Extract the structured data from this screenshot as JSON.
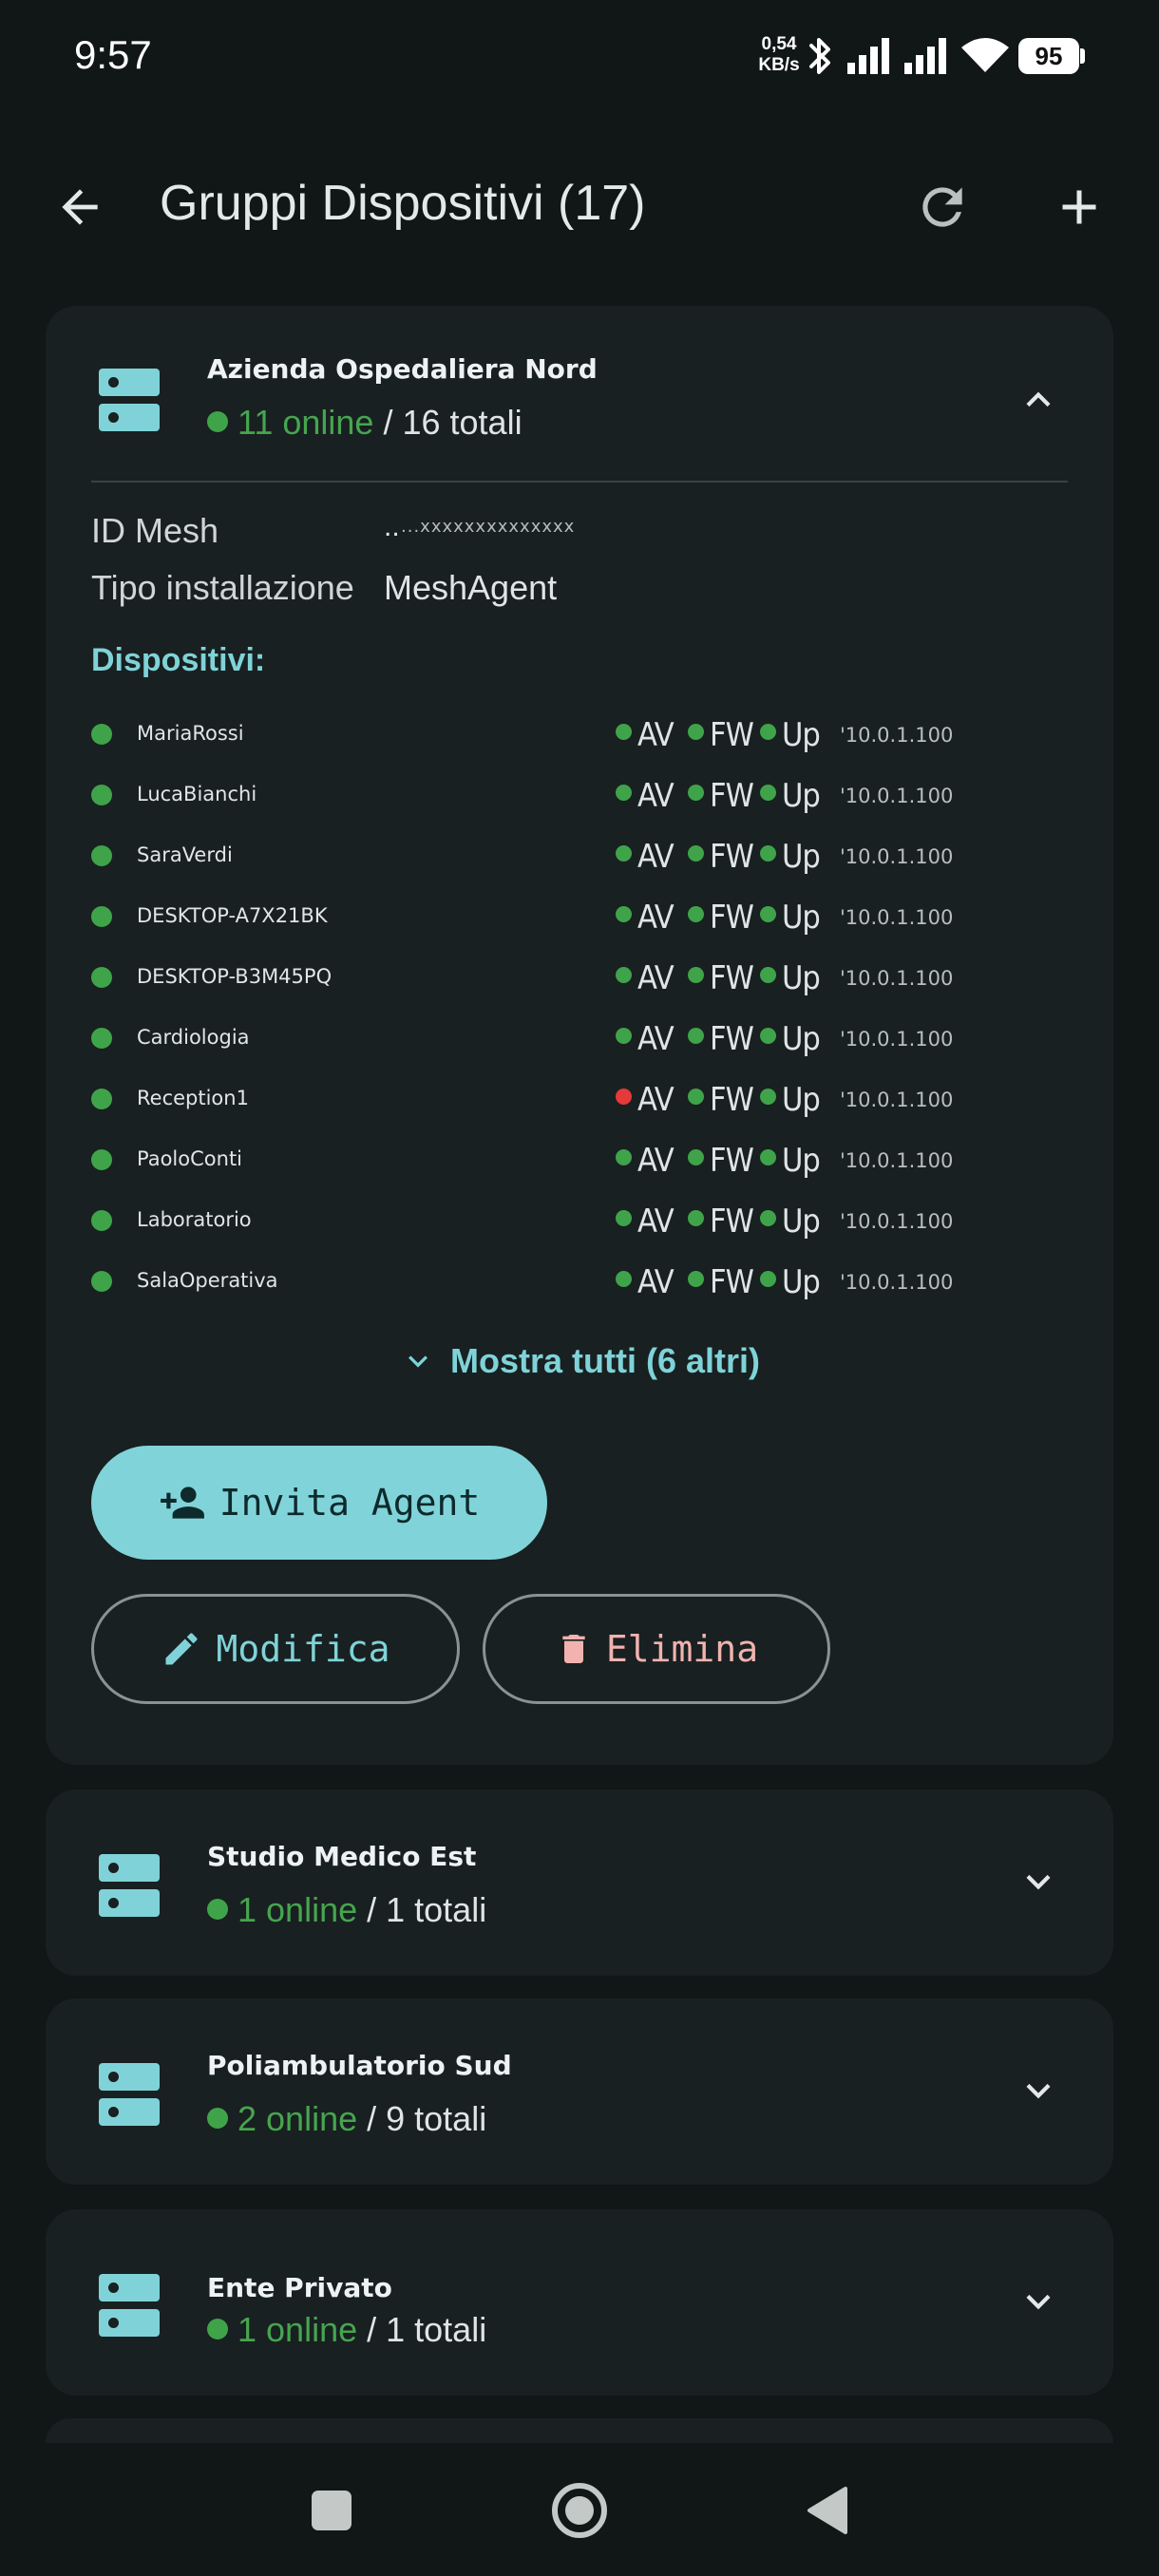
{
  "status_bar": {
    "time": "9:57",
    "net_speed_value": "0,54",
    "net_speed_unit": "KB/s",
    "battery": "95",
    "icons": [
      "bluetooth-icon",
      "signal-icon",
      "signal-icon",
      "wifi-icon",
      "battery-icon"
    ]
  },
  "app_bar": {
    "title": "Gruppi Dispositivi (17)",
    "back_icon": "arrow-back-icon",
    "refresh_icon": "refresh-icon",
    "add_icon": "add-icon"
  },
  "groups": [
    {
      "name": "Azienda Ospedaliera Nord",
      "online": "11 online",
      "totals": "/ 16 totali",
      "expanded": true,
      "mesh_id_label": "ID Mesh",
      "mesh_id_value": "..",
      "mesh_id_masked": "...xxxxxxxxxxxxxx",
      "install_type_label": "Tipo installazione",
      "install_type_value": "MeshAgent",
      "devices_title": "Dispositivi:",
      "devices": [
        {
          "name": "MariaRossi",
          "av": "AV",
          "fw": "FW",
          "up": "Up",
          "ip": "'10.0.1.100",
          "av_ok": true
        },
        {
          "name": "LucaBianchi",
          "av": "AV",
          "fw": "FW",
          "up": "Up",
          "ip": "'10.0.1.100",
          "av_ok": true
        },
        {
          "name": "SaraVerdi",
          "av": "AV",
          "fw": "FW",
          "up": "Up",
          "ip": "'10.0.1.100",
          "av_ok": true
        },
        {
          "name": "DESKTOP-A7X21BK",
          "av": "AV",
          "fw": "FW",
          "up": "Up",
          "ip": "'10.0.1.100",
          "av_ok": true
        },
        {
          "name": "DESKTOP-B3M45PQ",
          "av": "AV",
          "fw": "FW",
          "up": "Up",
          "ip": "'10.0.1.100",
          "av_ok": true
        },
        {
          "name": "Cardiologia",
          "av": "AV",
          "fw": "FW",
          "up": "Up",
          "ip": "'10.0.1.100",
          "av_ok": true
        },
        {
          "name": "Reception1",
          "av": "AV",
          "fw": "FW",
          "up": "Up",
          "ip": "'10.0.1.100",
          "av_ok": false
        },
        {
          "name": "PaoloConti",
          "av": "AV",
          "fw": "FW",
          "up": "Up",
          "ip": "'10.0.1.100",
          "av_ok": true
        },
        {
          "name": "Laboratorio",
          "av": "AV",
          "fw": "FW",
          "up": "Up",
          "ip": "'10.0.1.100",
          "av_ok": true
        },
        {
          "name": "SalaOperativa",
          "av": "AV",
          "fw": "FW",
          "up": "Up",
          "ip": "'10.0.1.100",
          "av_ok": true
        }
      ],
      "show_all_label": "Mostra tutti (6 altri)",
      "invite_label": "Invita Agent",
      "edit_label": "Modifica",
      "delete_label": "Elimina"
    },
    {
      "name": "Studio Medico Est",
      "online": "1 online",
      "totals": "/ 1 totali",
      "expanded": false
    },
    {
      "name": "Poliambulatorio Sud",
      "online": "2 online",
      "totals": "/ 9 totali",
      "expanded": false
    },
    {
      "name": "Ente Privato",
      "online": "1 online",
      "totals": "/ 1 totali",
      "expanded": false
    }
  ],
  "colors": {
    "background": "#111617",
    "card": "#192021",
    "accent": "#7fd3d8",
    "online_green": "#46a54f",
    "status_red": "#e5393a",
    "delete_pink": "#f2b3b0"
  },
  "nav_bar": {
    "items": [
      "recents-square-icon",
      "home-circle-icon",
      "back-triangle-icon"
    ]
  }
}
